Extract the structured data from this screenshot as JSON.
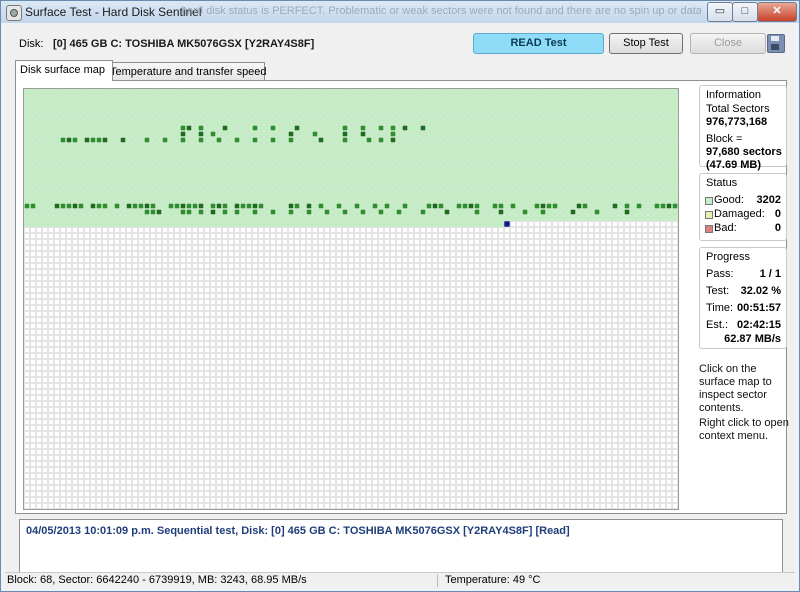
{
  "window": {
    "title": "Surface Test - Hard Disk Sentinel",
    "background_text": "hard disk status is PERFECT. Problematic or weak sectors were not found and there are no spin up or data tra",
    "minimize": "▭",
    "maximize": "□",
    "close": "✕"
  },
  "disk": {
    "label": "Disk:",
    "value": "[0] 465 GB C: TOSHIBA MK5076GSX [Y2RAY4S8F]"
  },
  "toolbar": {
    "read_test": "READ Test",
    "stop_test": "Stop Test",
    "close": "Close"
  },
  "tabs": [
    {
      "label": "Disk surface map"
    },
    {
      "label": "Temperature and transfer speed"
    }
  ],
  "information": {
    "title": "Information",
    "total_sectors_label": "Total Sectors",
    "total_sectors": "976,773,168",
    "block_label": "Block =",
    "block_sectors": "97,680 sectors",
    "block_mb": "(47.69 MB)"
  },
  "status": {
    "title": "Status",
    "good_label": "Good:",
    "good_value": "3202",
    "damaged_label": "Damaged:",
    "damaged_value": "0",
    "bad_label": "Bad:",
    "bad_value": "0"
  },
  "progress": {
    "title": "Progress",
    "pass_label": "Pass:",
    "pass_value": "1 / 1",
    "test_label": "Test:",
    "test_value": "32.02 %",
    "time_label": "Time:",
    "time_value": "00:51:57",
    "est_label": "Est.:",
    "est_value": "02:42:15",
    "speed": "62.87 MB/s"
  },
  "hints": {
    "click": "Click on the surface map to inspect sector contents.",
    "right_click": "Right click to open context menu."
  },
  "log": {
    "entry": "04/05/2013  10:01:09 p.m.   Sequential test, Disk: [0] 465 GB C: TOSHIBA MK5076GSX [Y2RAY4S8F] [Read]"
  },
  "statusbar": {
    "left": "Block: 68, Sector: 6642240 - 6739919, MB: 3243, 68.95 MB/s",
    "right": "Temperature: 49  °C"
  },
  "colors": {
    "good_block": "#c6eec6",
    "good_dark": "#2f8f2f",
    "good_darker": "#1f6b1f",
    "current_block": "#0a1a8a",
    "damaged": "#e8f0b0",
    "bad": "#e08080",
    "empty_cell_border": "#c8c8c8"
  },
  "surface_map": {
    "tested_fraction": 0.3202
  }
}
